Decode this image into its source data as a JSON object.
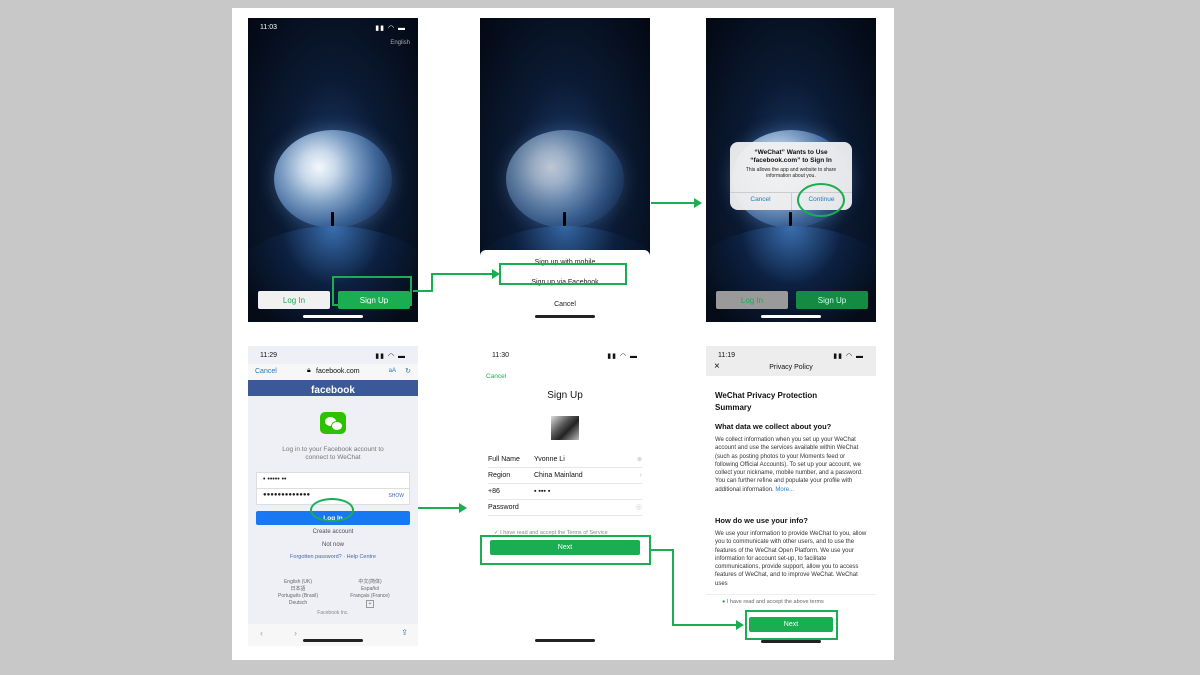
{
  "phone1": {
    "time": "11:03",
    "language": "English",
    "login_label": "Log In",
    "signup_label": "Sign Up"
  },
  "phone2": {
    "menu_items": [
      "Sign up with mobile",
      "Sign up via Facebook",
      "Cancel"
    ]
  },
  "phone3": {
    "dialog_title": "“WeChat” Wants to Use “facebook.com” to Sign In",
    "dialog_body": "This allows the app and website to share information about you.",
    "cancel_label": "Cancel",
    "continue_label": "Continue",
    "login_label": "Log In",
    "signup_label": "Sign Up"
  },
  "phone4": {
    "time": "11:29",
    "cancel_label": "Cancel",
    "url": "facebook.com",
    "text_size": "aA",
    "brand": "facebook",
    "prompt": "Log in to your Facebook account to connect to WeChat",
    "username": "• ••••• ••",
    "password": "●●●●●●●●●●●●●",
    "show_label": "SHOW",
    "login_label": "Log In",
    "create_account": "Create account",
    "not_now": "Not now",
    "forgotten": "Forgotten password? · Help Centre",
    "lang_left": [
      "English (UK)",
      "日本語",
      "Português (Brasil)",
      "Deutsch"
    ],
    "lang_right": [
      "中文(简体)",
      "Español",
      "Français (France)",
      "+"
    ],
    "footer": "Facebook Inc."
  },
  "phone5": {
    "time": "11:30",
    "cancel_label": "Cancel",
    "title": "Sign Up",
    "rows": [
      {
        "label": "Full Name",
        "value": "Yvonne Li"
      },
      {
        "label": "Region",
        "value": "China Mainland"
      },
      {
        "label": "+86",
        "value": "▪ ▪▪▪ ▪"
      },
      {
        "label": "Password",
        "value": ""
      }
    ],
    "terms": "I have read and accept the Terms of Service",
    "next_label": "Next"
  },
  "phone6": {
    "time": "11:19",
    "close": "×",
    "header": "Privacy Policy",
    "title1": "WeChat Privacy Protection",
    "title2": "Summary",
    "q1": "What data we collect about you?",
    "p1": "We collect information when you set up your WeChat account and use the services available within WeChat (such as posting photos to your Moments feed or following Official Accounts). To set up your account, we collect your nickname, mobile number, and a password. You can further refine and populate your profile with additional information.",
    "more": "More...",
    "q2": "How do we use your info?",
    "p2": "We use your information to provide WeChat to you, allow you to communicate with other users, and to use the features of the WeChat Open Platform. We use your information for account set-up, to facilitate communications, provide support, allow you to access features of WeChat, and to improve WeChat. WeChat uses",
    "accept": "I have read and accept the above terms",
    "next_label": "Next"
  },
  "colors": {
    "accent": "#1aad52",
    "link": "#1d7bbf",
    "facebook": "#3b5998"
  }
}
